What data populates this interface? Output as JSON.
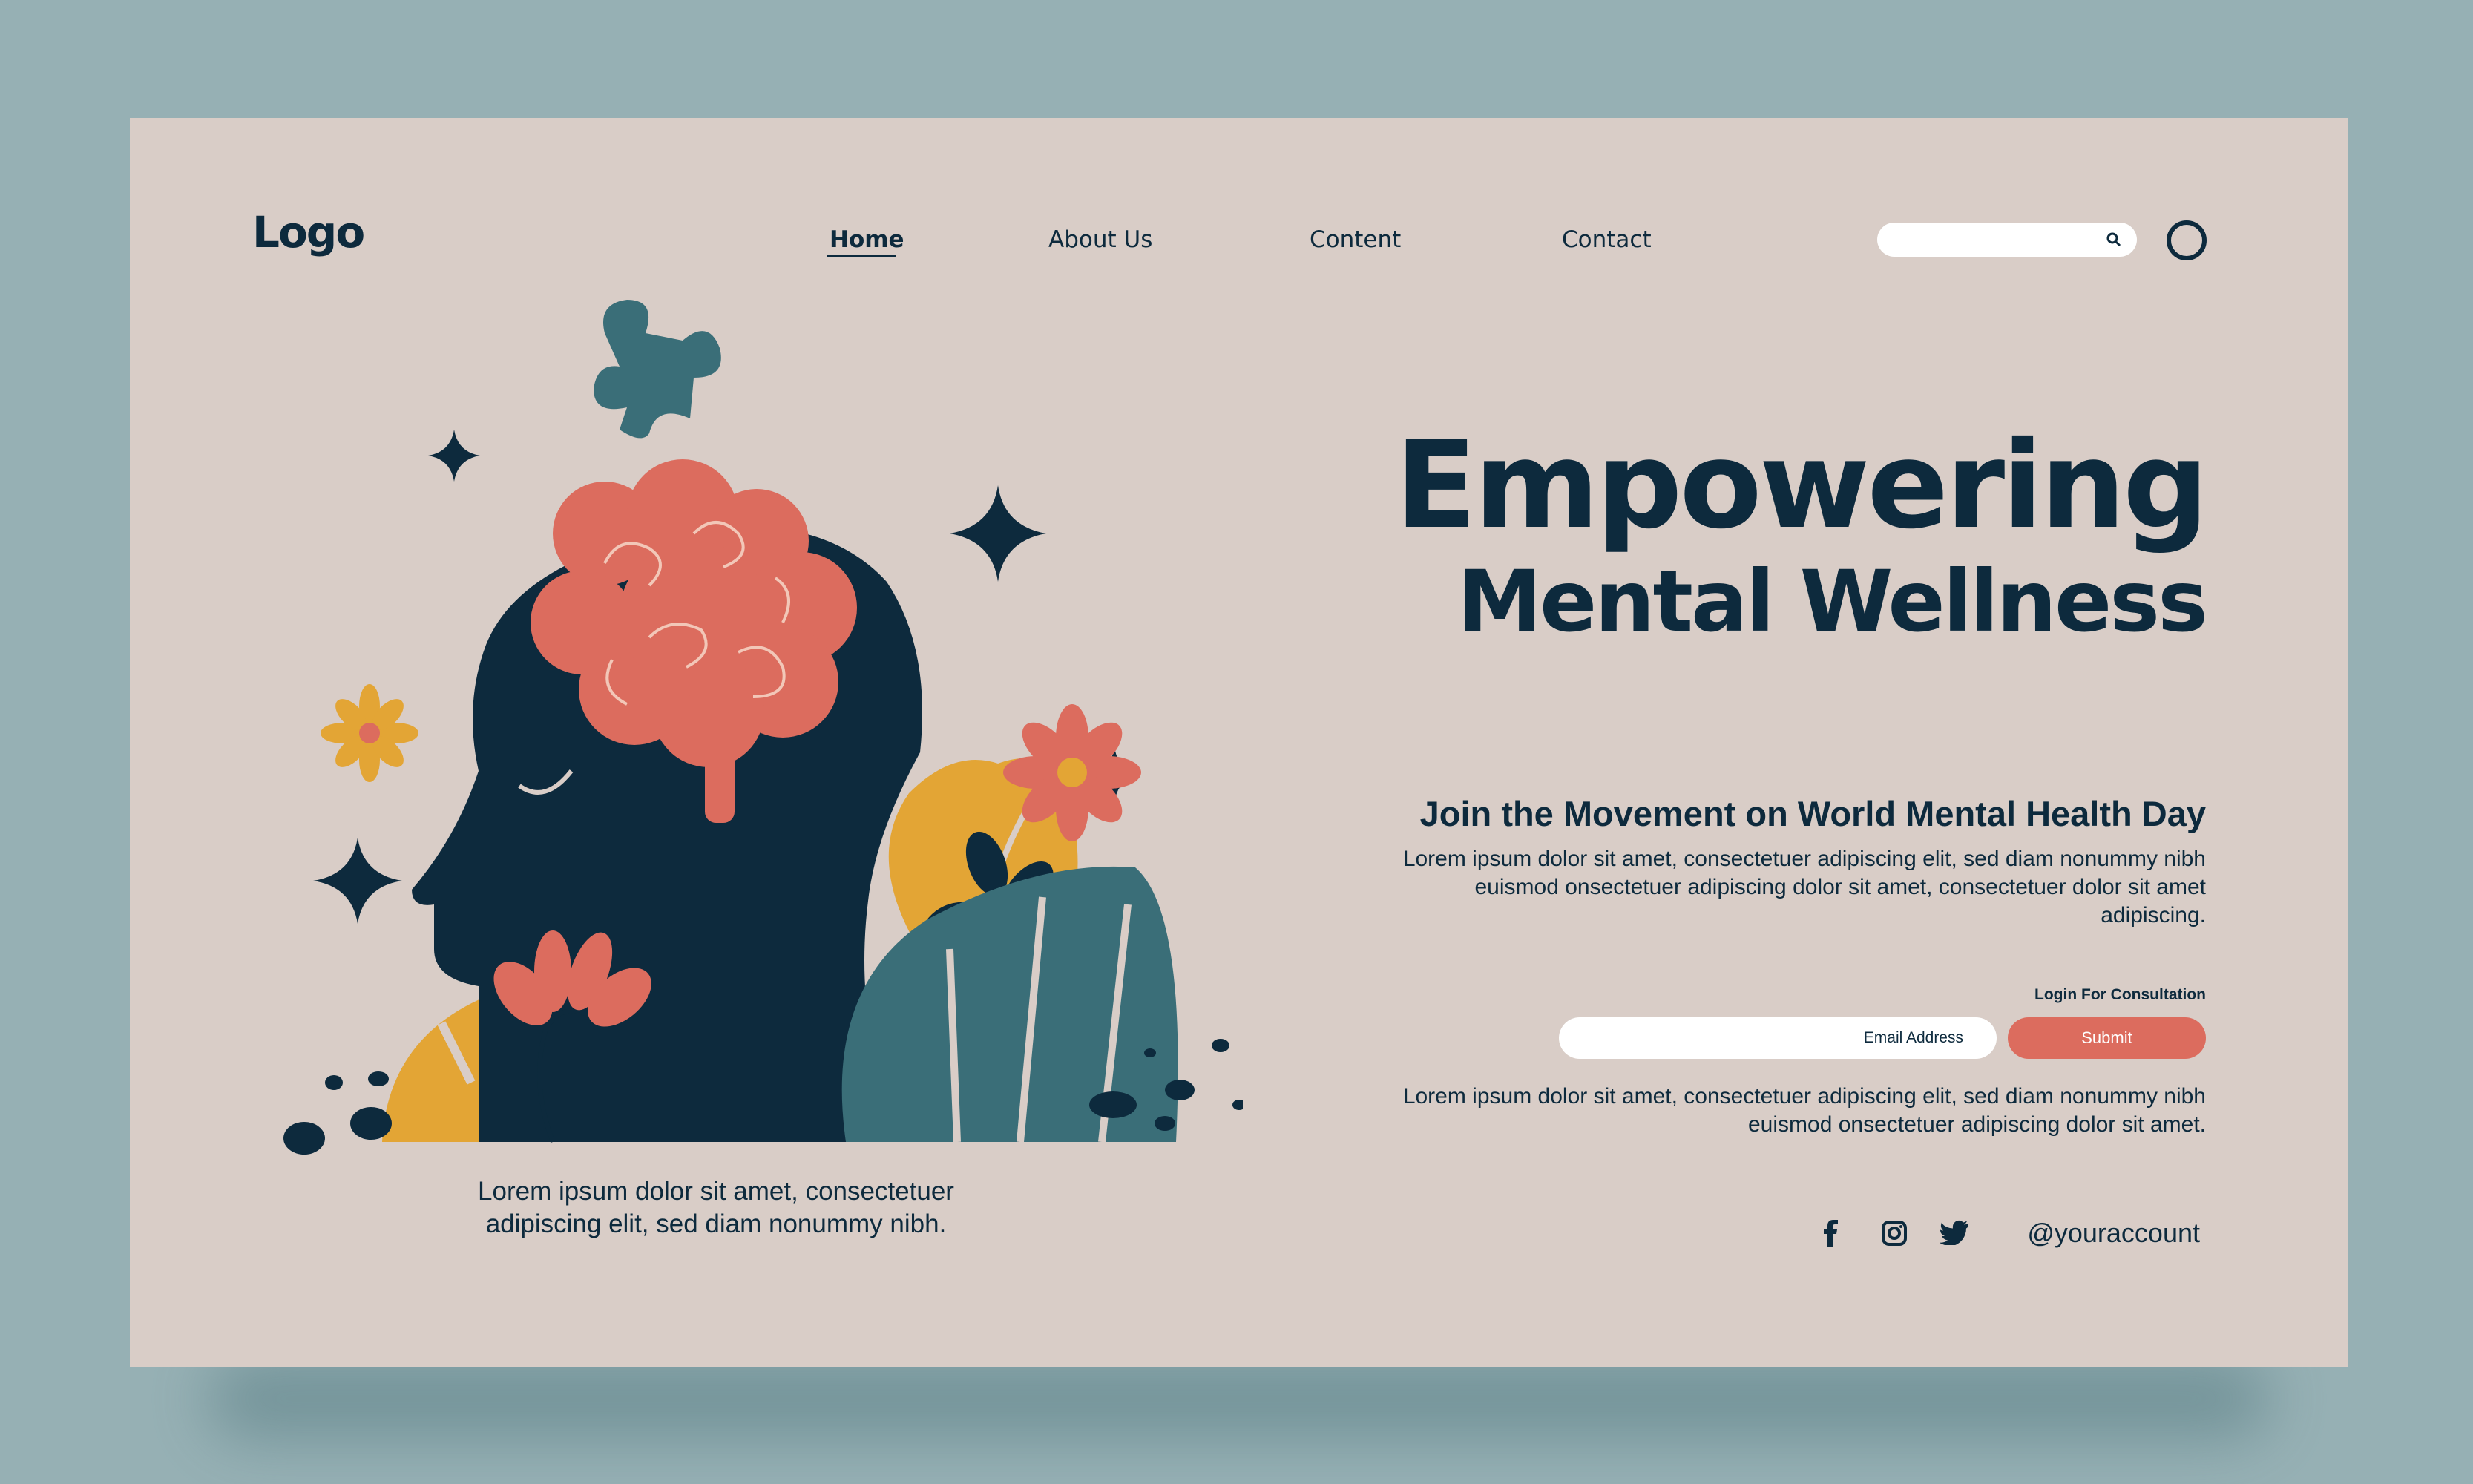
{
  "header": {
    "logo": "Logo",
    "nav": [
      "Home",
      "About Us",
      "Content",
      "Contact"
    ],
    "active_nav": "Home",
    "search_placeholder": "",
    "icons": [
      "search-icon",
      "profile-circle-icon"
    ]
  },
  "hero": {
    "line1": "Empowering",
    "line2": "Mental Wellness"
  },
  "section": {
    "heading": "Join the Movement on World Mental Health Day",
    "paragraph": "Lorem ipsum dolor sit amet, consectetuer adipiscing elit, sed diam nonummy nibh euismod onsectetuer adipiscing dolor sit amet, consectetuer dolor sit amet adipiscing."
  },
  "form": {
    "label": "Login For Consultation",
    "email_placeholder": "Email Address",
    "submit_label": "Submit"
  },
  "footer_paragraph": "Lorem ipsum dolor sit amet, consectetuer adipiscing elit, sed diam nonummy nibh euismod onsectetuer adipiscing dolor sit amet.",
  "illustration_caption": "Lorem ipsum dolor sit amet, consectetuer adipiscing elit, sed diam nonummy nibh.",
  "social": {
    "icons": [
      "facebook-icon",
      "instagram-icon",
      "twitter-icon"
    ],
    "handle": "@youraccount"
  },
  "colors": {
    "background": "#96b0b4",
    "page": "#d9cdc7",
    "navy": "#0d2a3d",
    "coral": "#dc6c5e",
    "mustard": "#e3a535",
    "teal": "#3a6e78"
  }
}
